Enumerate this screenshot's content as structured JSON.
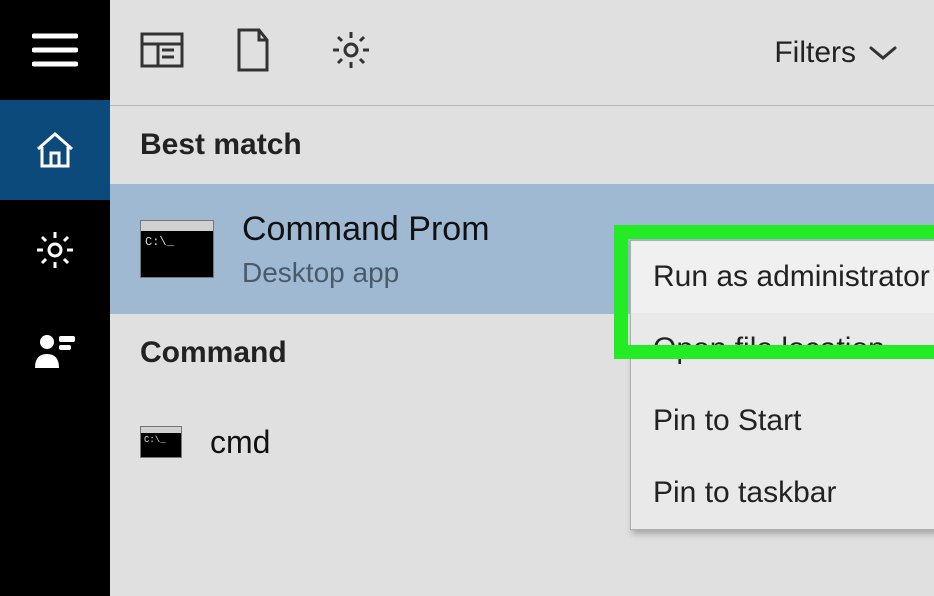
{
  "sidebar": {
    "items": [
      {
        "name": "menu-button"
      },
      {
        "name": "home-button",
        "active": true
      },
      {
        "name": "settings-button"
      },
      {
        "name": "people-button"
      }
    ]
  },
  "toolbar": {
    "filters_label": "Filters"
  },
  "sections": {
    "best_match_label": "Best match",
    "command_label": "Command"
  },
  "best_match": {
    "title": "Command Prom",
    "subtitle": "Desktop app",
    "thumb_prompt": "C:\\_"
  },
  "command_result": {
    "title": "cmd",
    "thumb_prompt": "C:\\_"
  },
  "context_menu": {
    "items": [
      "Run as administrator",
      "Open file location",
      "Pin to Start",
      "Pin to taskbar"
    ]
  }
}
